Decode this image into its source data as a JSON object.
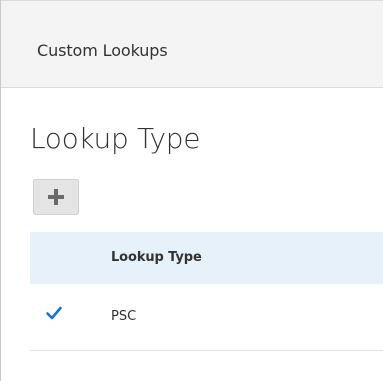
{
  "header": {
    "title": "Custom Lookups"
  },
  "section": {
    "title": "Lookup Type"
  },
  "toolbar": {
    "add_icon": "plus-icon"
  },
  "table": {
    "columns": [
      "Lookup Type"
    ],
    "rows": [
      {
        "selected": true,
        "selected_icon": "checkmark-icon",
        "lookup_type": "PSC"
      }
    ]
  },
  "colors": {
    "header_background": "#f4f4f4",
    "table_header_background": "#e7f1fa",
    "selection_check": "#1a73c9",
    "add_button_background": "#e5e5e5"
  }
}
